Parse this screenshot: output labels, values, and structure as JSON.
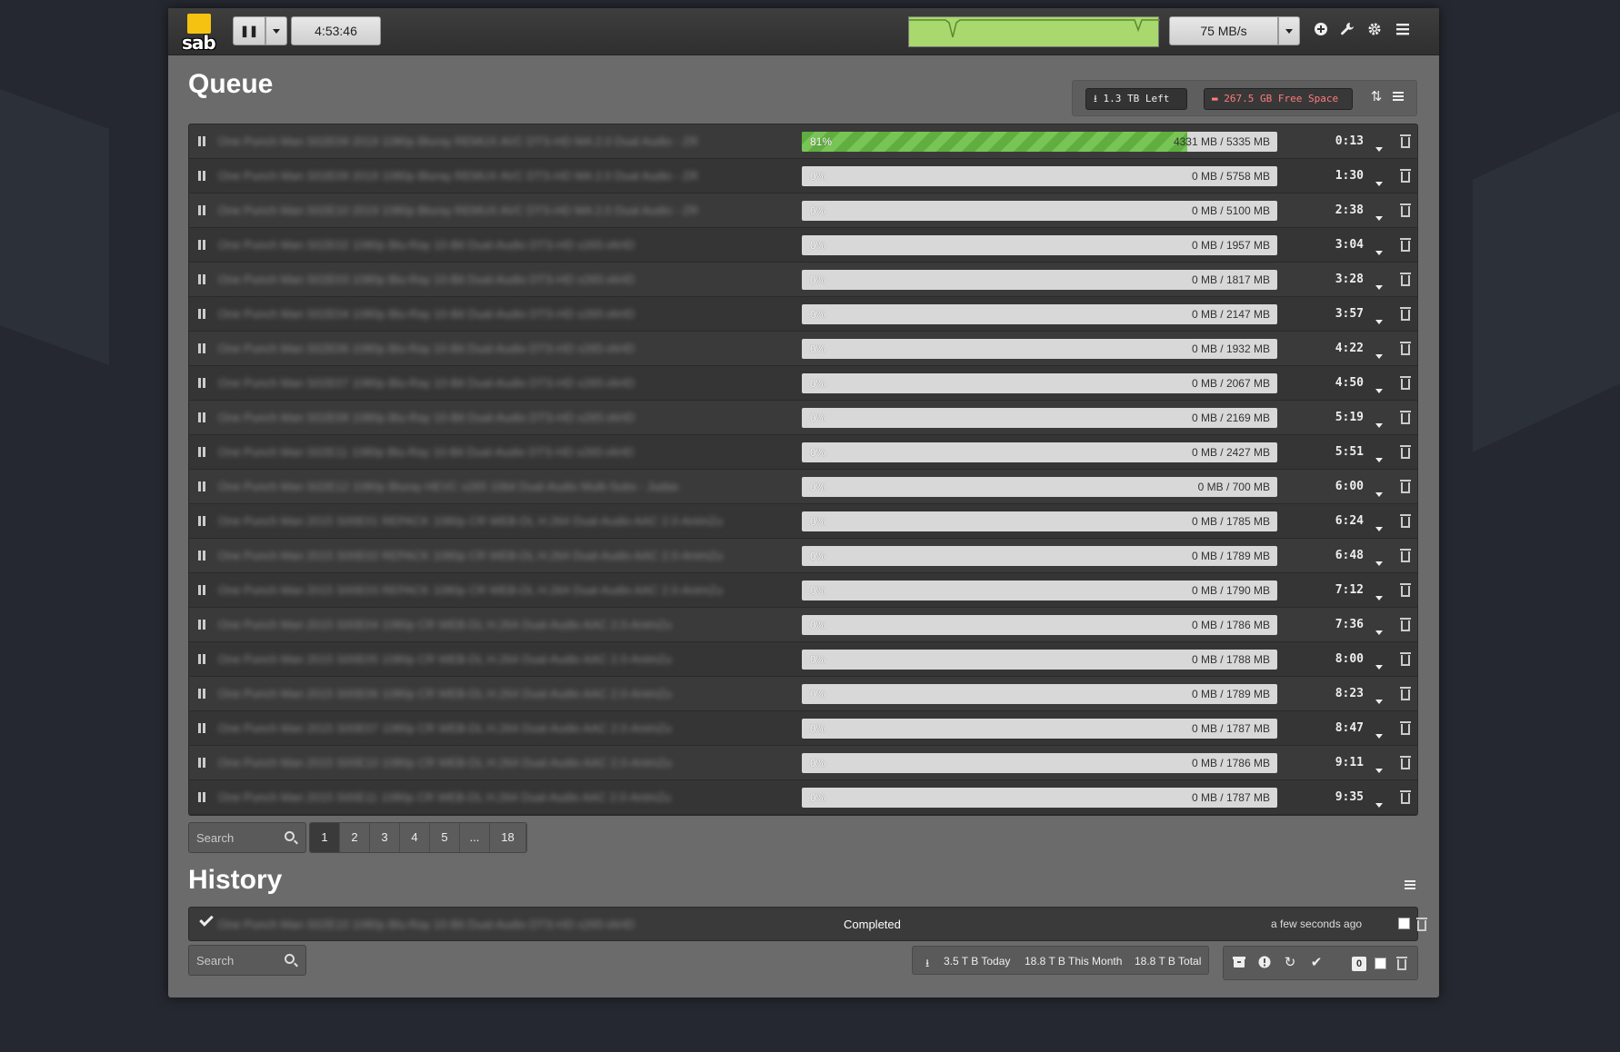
{
  "topbar": {
    "logo_text": "sab",
    "timer": "4:53:46",
    "speed": "75 MB/s",
    "icons": [
      "add-icon",
      "wrench-icon",
      "gear-icon",
      "menu-icon"
    ]
  },
  "queue": {
    "title": "Queue",
    "left_label": "1.3 TB Left",
    "free_label": "267.5 GB Free Space",
    "search_placeholder": "Search",
    "items": [
      {
        "name": "One Punch Man S02E09 2019 1080p Bluray REMUX AVC DTS-HD MA 2.0 Dual Audio - ZR",
        "pct": "81%",
        "progress": 0.81,
        "size": "4331 MB / 5335 MB",
        "eta": "0:13"
      },
      {
        "name": "One Punch Man S02E09 2019 1080p Bluray REMUX AVC DTS-HD MA 2.0 Dual Audio - ZR",
        "pct": "0%",
        "progress": 0,
        "size": "0 MB / 5758 MB",
        "eta": "1:30"
      },
      {
        "name": "One Punch Man S02E10 2019 1080p Bluray REMUX AVC DTS-HD MA 2.0 Dual Audio - ZR",
        "pct": "0%",
        "progress": 0,
        "size": "0 MB / 5100 MB",
        "eta": "2:38"
      },
      {
        "name": "One Punch Man S02E02 1080p Blu-Ray 10-Bit Dual-Audio DTS-HD x265-iAHD",
        "pct": "0%",
        "progress": 0,
        "size": "0 MB / 1957 MB",
        "eta": "3:04"
      },
      {
        "name": "One Punch Man S02E03 1080p Blu-Ray 10-Bit Dual-Audio DTS-HD x265-iAHD",
        "pct": "0%",
        "progress": 0,
        "size": "0 MB / 1817 MB",
        "eta": "3:28"
      },
      {
        "name": "One Punch Man S02E04 1080p Blu-Ray 10-Bit Dual-Audio DTS-HD x265-iAHD",
        "pct": "0%",
        "progress": 0,
        "size": "0 MB / 2147 MB",
        "eta": "3:57"
      },
      {
        "name": "One Punch Man S02E06 1080p Blu-Ray 10-Bit Dual-Audio DTS-HD x265-iAHD",
        "pct": "0%",
        "progress": 0,
        "size": "0 MB / 1932 MB",
        "eta": "4:22"
      },
      {
        "name": "One Punch Man S02E07 1080p Blu-Ray 10-Bit Dual-Audio DTS-HD x265-iAHD",
        "pct": "0%",
        "progress": 0,
        "size": "0 MB / 2067 MB",
        "eta": "4:50"
      },
      {
        "name": "One Punch Man S02E08 1080p Blu-Ray 10-Bit Dual-Audio DTS-HD x265-iAHD",
        "pct": "0%",
        "progress": 0,
        "size": "0 MB / 2169 MB",
        "eta": "5:19"
      },
      {
        "name": "One Punch Man S02E11 1080p Blu-Ray 10-Bit Dual-Audio DTS-HD x265-iAHD",
        "pct": "0%",
        "progress": 0,
        "size": "0 MB / 2427 MB",
        "eta": "5:51"
      },
      {
        "name": "One Punch Man S02E12 1080p Bluray HEVC x265 10bit Dual-Audio Multi-Subs - Judas",
        "pct": "0%",
        "progress": 0,
        "size": "0 MB / 700 MB",
        "eta": "6:00"
      },
      {
        "name": "One Punch Man 2015 S00E01 REPACK 1080p CR WEB-DL H.264 Dual-Audio AAC 2.0-AnimZu",
        "pct": "0%",
        "progress": 0,
        "size": "0 MB / 1785 MB",
        "eta": "6:24"
      },
      {
        "name": "One Punch Man 2015 S00E02 REPACK 1080p CR WEB-DL H.264 Dual-Audio AAC 2.0-AnimZu",
        "pct": "0%",
        "progress": 0,
        "size": "0 MB / 1789 MB",
        "eta": "6:48"
      },
      {
        "name": "One Punch Man 2015 S00E03 REPACK 1080p CR WEB-DL H.264 Dual-Audio AAC 2.0-AnimZu",
        "pct": "0%",
        "progress": 0,
        "size": "0 MB / 1790 MB",
        "eta": "7:12"
      },
      {
        "name": "One Punch Man 2015 S00E04 1080p CR WEB-DL H.264 Dual-Audio AAC 2.0-AnimZu",
        "pct": "0%",
        "progress": 0,
        "size": "0 MB / 1786 MB",
        "eta": "7:36"
      },
      {
        "name": "One Punch Man 2015 S00E05 1080p CR WEB-DL H.264 Dual-Audio AAC 2.0-AnimZu",
        "pct": "0%",
        "progress": 0,
        "size": "0 MB / 1788 MB",
        "eta": "8:00"
      },
      {
        "name": "One Punch Man 2015 S00E06 1080p CR WEB-DL H.264 Dual-Audio AAC 2.0-AnimZu",
        "pct": "0%",
        "progress": 0,
        "size": "0 MB / 1789 MB",
        "eta": "8:23"
      },
      {
        "name": "One Punch Man 2015 S00E07 1080p CR WEB-DL H.264 Dual-Audio AAC 2.0-AnimZu",
        "pct": "0%",
        "progress": 0,
        "size": "0 MB / 1787 MB",
        "eta": "8:47"
      },
      {
        "name": "One Punch Man 2015 S00E10 1080p CR WEB-DL H.264 Dual-Audio AAC 2.0-AnimZu",
        "pct": "0%",
        "progress": 0,
        "size": "0 MB / 1786 MB",
        "eta": "9:11"
      },
      {
        "name": "One Punch Man 2015 S00E11 1080p CR WEB-DL H.264 Dual-Audio AAC 2.0-AnimZu",
        "pct": "0%",
        "progress": 0,
        "size": "0 MB / 1787 MB",
        "eta": "9:35"
      }
    ],
    "pages": [
      "1",
      "2",
      "3",
      "4",
      "5",
      "...",
      "18"
    ]
  },
  "history": {
    "title": "History",
    "search_placeholder": "Search",
    "item": {
      "name": "One Punch Man S02E10 1080p Blu-Ray 10-Bit Dual-Audio DTS-HD x265-iAHD",
      "status": "Completed",
      "time": "a few seconds ago"
    },
    "stats": {
      "today": "3.5 T B Today",
      "month": "18.8 T B This Month",
      "total": "18.8 T B Total"
    },
    "badge": "0"
  },
  "colors": {
    "progress": "#6cbf4a",
    "free_space": "#ff7a7a",
    "graph": "#a9d86e"
  }
}
